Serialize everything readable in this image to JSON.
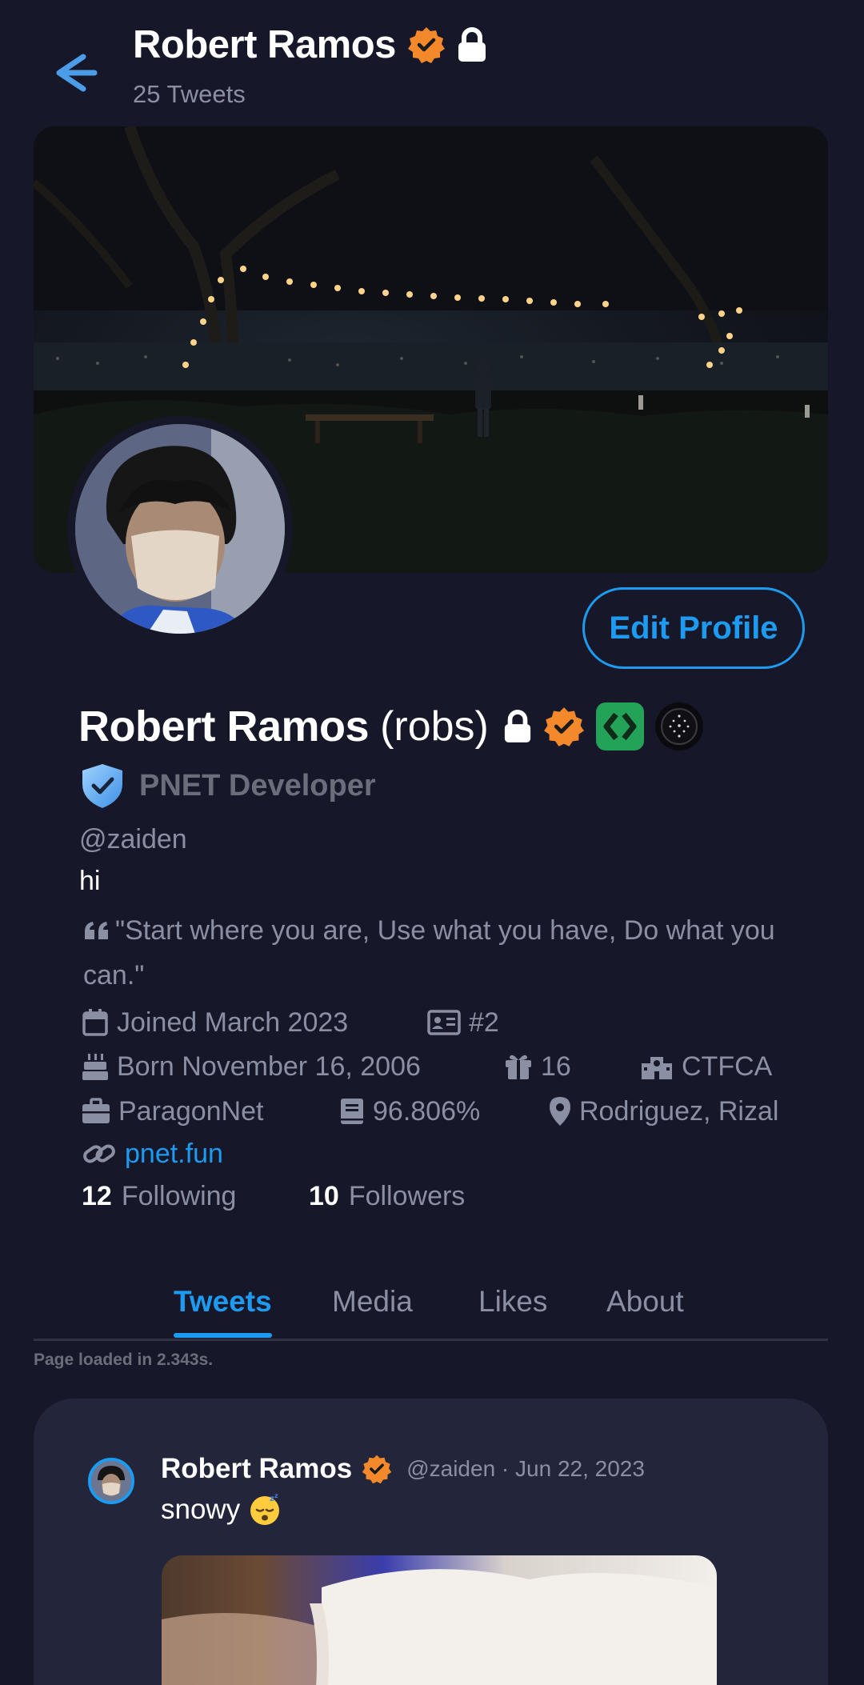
{
  "header": {
    "name": "Robert Ramos",
    "tweet_count": "25 Tweets",
    "back_icon": "arrow-left-icon",
    "verified_icon": "verified-badge-icon",
    "lock_icon": "lock-icon"
  },
  "profile": {
    "edit_button": "Edit Profile",
    "display_name": "Robert Ramos",
    "nickname": "(robs)",
    "role": "PNET Developer",
    "handle": "@zaiden",
    "bio": "hi",
    "quote": "\"Start where you are, Use what you have, Do what you can.\"",
    "joined": "Joined March 2023",
    "id_number": "#2",
    "born": "Born November 16, 2006",
    "age": "16",
    "school": "CTFCA",
    "work": "ParagonNet",
    "percentage": "96.806%",
    "location": "Rodriguez, Rizal",
    "website": "pnet.fun",
    "following_count": "12",
    "following_label": "Following",
    "followers_count": "10",
    "followers_label": "Followers"
  },
  "tabs": [
    "Tweets",
    "Media",
    "Likes",
    "About"
  ],
  "active_tab": "Tweets",
  "load_time": "Page loaded in 2.343s.",
  "tweet": {
    "author": "Robert Ramos",
    "meta": "@zaiden · Jun 22, 2023",
    "text": "snowy",
    "emoji": "sleeping-face-emoji"
  },
  "colors": {
    "background": "#161728",
    "accent": "#1d9bf0",
    "verified": "#f4892b",
    "muted": "#8b8fa3",
    "card": "#23253a"
  }
}
